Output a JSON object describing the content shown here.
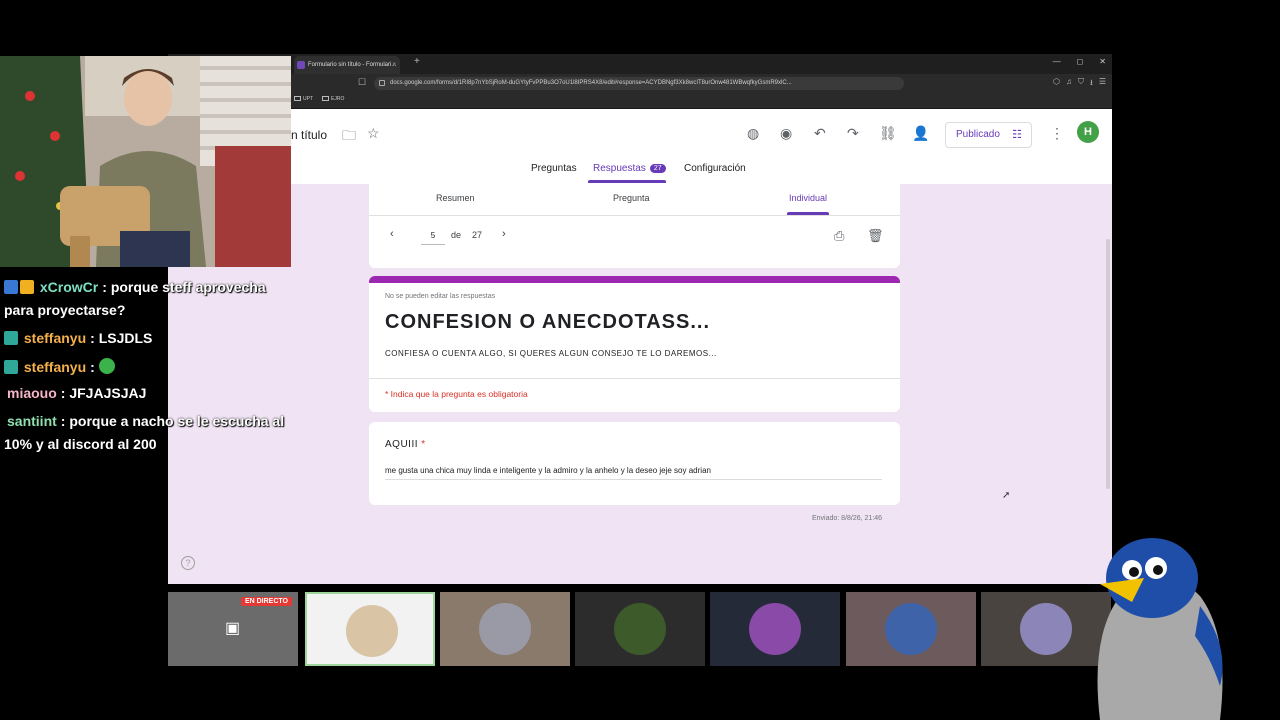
{
  "browser": {
    "tab_title": "Formulario sin título - Formulari...",
    "url": "docs.google.com/forms/d/1RI8p7nYbSjRoM-duGYtyFvPPBu3O7oU1l8IPRS4X8/edit#response=ACYDBNgf3Xk8wcIT8urOnw481WBwqfkyGsmR9xlC...",
    "bookmarks": [
      "UPT",
      "EJRO"
    ]
  },
  "forms": {
    "title": "n título",
    "publish_label": "Publicado",
    "avatar_initial": "H",
    "tabs": [
      "Preguntas",
      "Respuestas",
      "Configuración"
    ],
    "responses_count": "27",
    "subtabs": [
      "Resumen",
      "Pregunta",
      "Individual"
    ],
    "page_current": "5",
    "page_of": "de",
    "page_total": "27",
    "no_edit_note": "No se pueden editar las respuestas",
    "form_heading": "CONFESION O ANECDOTASS...",
    "form_description": "CONFIESA O CUENTA ALGO, SI QUERES ALGUN CONSEJO TE LO DAREMOS...",
    "required_note": "* Indica que la pregunta es obligatoria",
    "question_title": "AQUIII",
    "question_required_mark": "*",
    "answer": "me gusta una chica muy linda e inteligente y la admiro y la anhelo y la deseo jeje soy adrian",
    "sent": "Enviado: 8/8/26, 21:46"
  },
  "chat": [
    {
      "user": "xCrowCr",
      "user_color": "#7ee0c3",
      "text": "porque steff aprovecha"
    },
    {
      "user": "",
      "user_color": "#ffffff",
      "text": "para proyectarse?"
    },
    {
      "user": "steffanyu",
      "user_color": "#f4b04a",
      "text": "LSJDLS"
    },
    {
      "user": "steffanyu",
      "user_color": "#f4b04a",
      "text": ""
    },
    {
      "user": "miaouo",
      "user_color": "#f7b4c8",
      "text": "JFJAJSJAJ"
    },
    {
      "user": "santiint",
      "user_color": "#8fe0b0",
      "text": "porque a nacho se le escucha al"
    },
    {
      "user": "",
      "user_color": "#ffffff",
      "text": "10% y al discord al 200"
    }
  ],
  "participants": {
    "live_label": "EN DIRECTO",
    "count": 7
  }
}
